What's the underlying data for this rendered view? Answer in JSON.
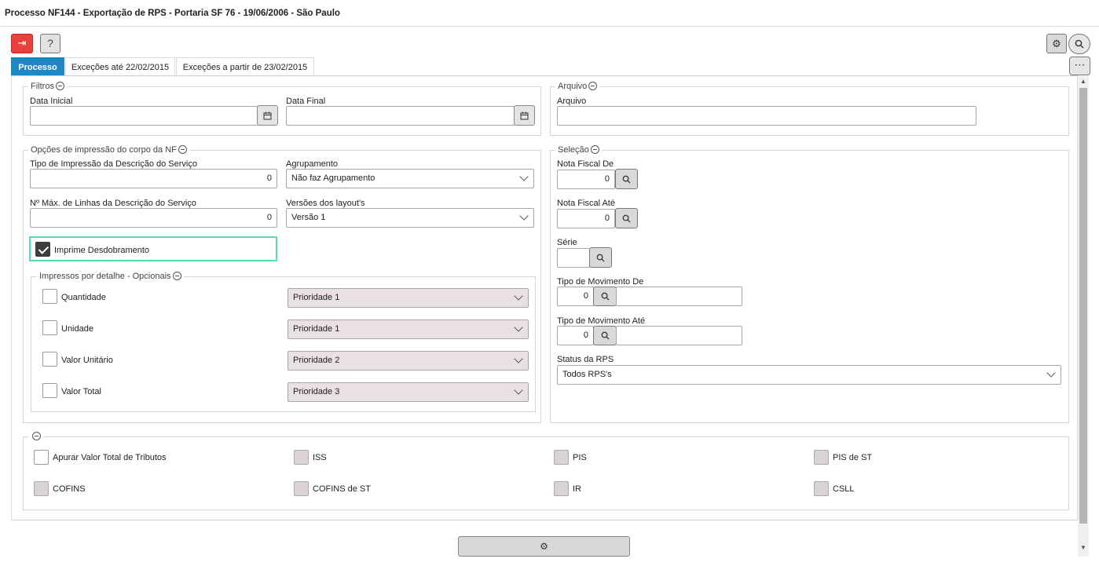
{
  "window": {
    "title": "Processo NF144 - Exportação de RPS - Portaria SF 76 - 19/06/2006 - São Paulo"
  },
  "toolbar": {
    "exit_icon": "exit-icon",
    "help_label": "?",
    "gear_icon": "⚙",
    "search_icon": "search-icon",
    "more_label": "⋯"
  },
  "tabs": [
    {
      "label": "Processo",
      "active": true
    },
    {
      "label": "Exceções até 22/02/2015",
      "active": false
    },
    {
      "label": "Exceções a partir de 23/02/2015",
      "active": false
    }
  ],
  "filtros": {
    "legend": "Filtros",
    "data_inicial_label": "Data Inicial",
    "data_inicial_value": "",
    "data_final_label": "Data Final",
    "data_final_value": ""
  },
  "arquivo": {
    "legend": "Arquivo",
    "label": "Arquivo",
    "value": ""
  },
  "opcoes": {
    "legend": "Opções de impressão do corpo da NF",
    "tipo_label": "Tipo de Impressão da Descrição do Serviço",
    "tipo_value": "0",
    "agrupamento_label": "Agrupamento",
    "agrupamento_value": "Não faz Agrupamento",
    "max_linhas_label": "Nº Máx. de Linhas da Descrição do Serviço",
    "max_linhas_value": "0",
    "versoes_label": "Versões dos layout's",
    "versoes_value": "Versão 1",
    "imprime_label": "Imprime Desdobramento",
    "imprime_checked": true
  },
  "impressos": {
    "legend": "Impressos por detalhe - Opcionais",
    "items": [
      {
        "label": "Quantidade",
        "prioridade": "Prioridade 1"
      },
      {
        "label": "Unidade",
        "prioridade": "Prioridade 1"
      },
      {
        "label": "Valor Unitário",
        "prioridade": "Prioridade 2"
      },
      {
        "label": "Valor Total",
        "prioridade": "Prioridade 3"
      }
    ]
  },
  "selecao": {
    "legend": "Seleção",
    "nf_de_label": "Nota Fiscal De",
    "nf_de_value": "0",
    "nf_ate_label": "Nota Fiscal Até",
    "nf_ate_value": "0",
    "serie_label": "Série",
    "serie_value": "",
    "mov_de_label": "Tipo de Movimento De",
    "mov_de_value": "0",
    "mov_ate_label": "Tipo de Movimento Até",
    "mov_ate_value": "0",
    "status_label": "Status da RPS",
    "status_value": "Todos RPS's"
  },
  "tributos": {
    "items": [
      {
        "label": "Apurar Valor Total de Tributos"
      },
      {
        "label": "ISS"
      },
      {
        "label": "PIS"
      },
      {
        "label": "PIS de ST"
      },
      {
        "label": "COFINS"
      },
      {
        "label": "COFINS de ST"
      },
      {
        "label": "IR"
      },
      {
        "label": "CSLL"
      }
    ]
  },
  "footer": {
    "run_icon": "⚙"
  }
}
